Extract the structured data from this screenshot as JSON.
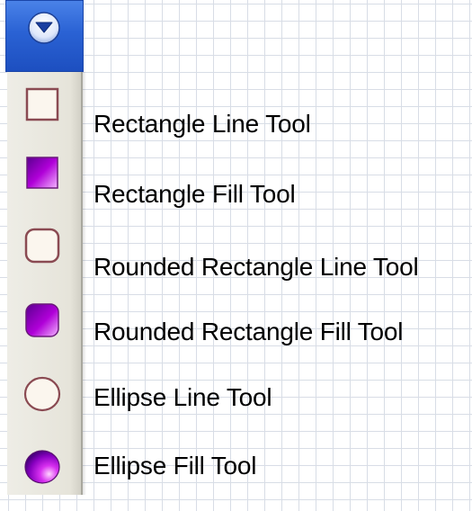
{
  "dropdown": {
    "icon": "chevron-down-icon",
    "accent": "#2a62d4"
  },
  "tools": [
    {
      "icon": "rectangle-outline-icon",
      "label": "Rectangle Line Tool"
    },
    {
      "icon": "rectangle-filled-icon",
      "label": "Rectangle Fill Tool"
    },
    {
      "icon": "rounded-rectangle-outline-icon",
      "label": "Rounded Rectangle Line Tool"
    },
    {
      "icon": "rounded-rectangle-filled-icon",
      "label": "Rounded Rectangle Fill Tool"
    },
    {
      "icon": "ellipse-outline-icon",
      "label": "Ellipse Line Tool"
    },
    {
      "icon": "ellipse-filled-icon",
      "label": "Ellipse Fill Tool"
    }
  ],
  "colors": {
    "outline_stroke": "#8a4a52",
    "fill_gradient_dark": "#6a00a0",
    "fill_gradient_light": "#f0a0ff",
    "palette_bg": "#e6e4da"
  }
}
